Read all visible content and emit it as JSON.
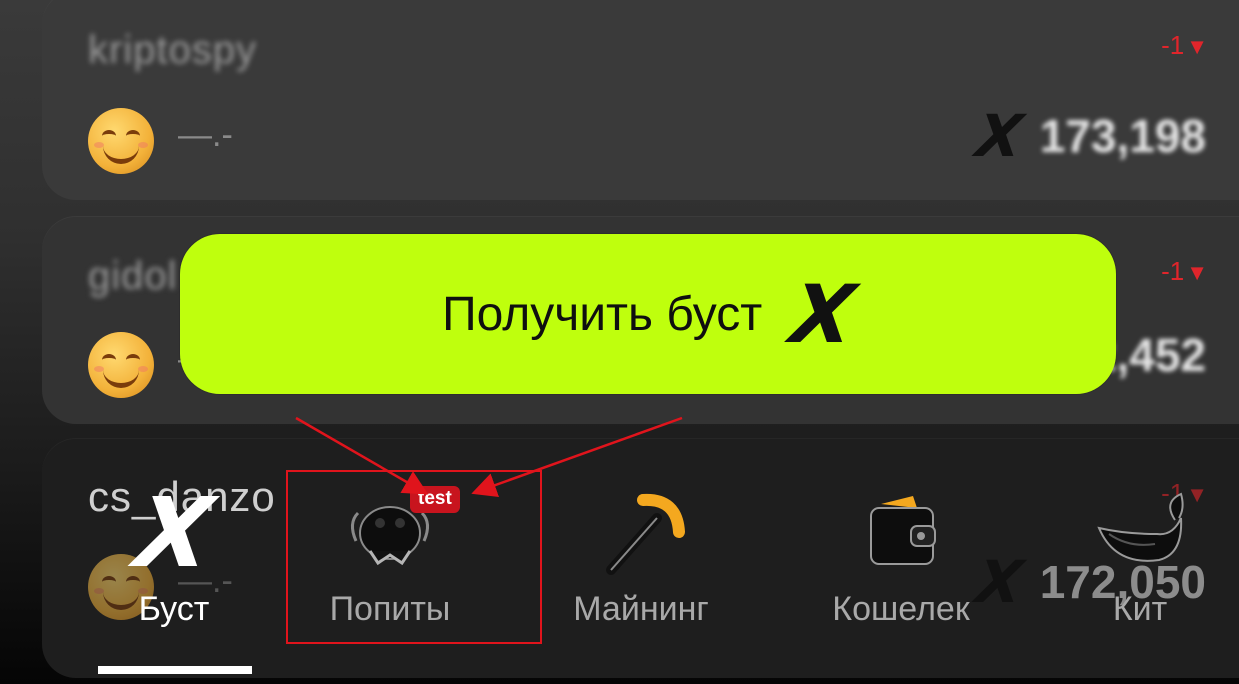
{
  "leaderboard": [
    {
      "username": "kriptospy",
      "rank_change": "-1",
      "status": "—.-",
      "score": "173,198"
    },
    {
      "username": "gidol",
      "rank_change": "-1",
      "status": "—.-",
      "score": "172,452"
    },
    {
      "username": "cs_danzo",
      "rank_change": "-1",
      "status": "—.-",
      "score": "172,050"
    }
  ],
  "boost_button": {
    "label": "Получить буст",
    "logo": "X"
  },
  "nav": {
    "items": [
      {
        "label": "Буст",
        "icon": "x-logo-icon",
        "active": true
      },
      {
        "label": "Попиты",
        "icon": "popit-icon",
        "badge": "test"
      },
      {
        "label": "Майнинг",
        "icon": "pickaxe-icon"
      },
      {
        "label": "Кошелек",
        "icon": "wallet-icon"
      },
      {
        "label": "Кит",
        "icon": "whale-icon"
      }
    ]
  },
  "colors": {
    "accent": "#bfff0d",
    "rank_down": "#e0252b",
    "badge": "#c8141e",
    "annotation": "#e0141c"
  }
}
